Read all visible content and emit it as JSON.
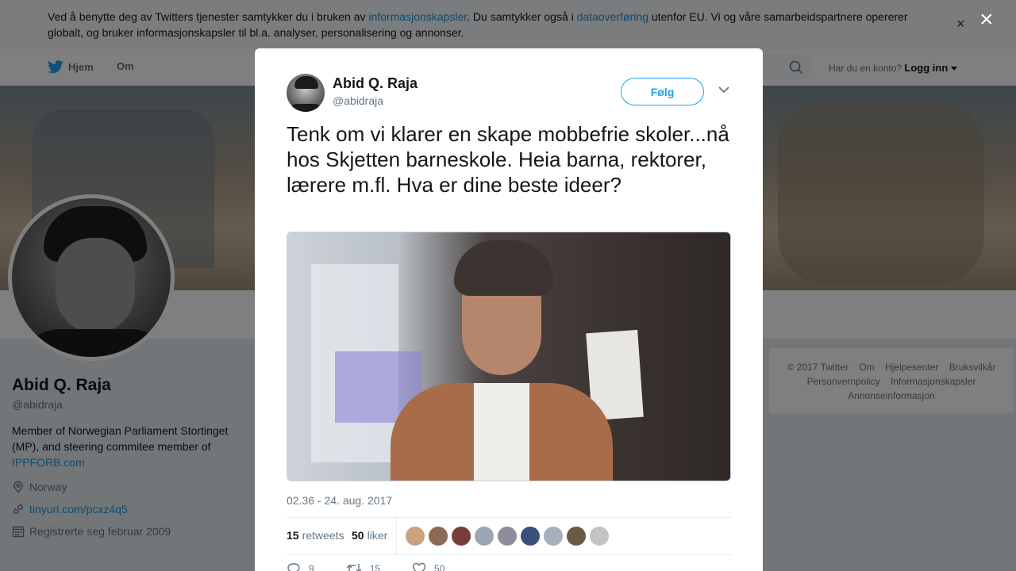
{
  "cookie_banner": {
    "text_before": "Ved å benytte deg av Twitters tjenester samtykker du i bruken av ",
    "link1": "informasjonskapsler",
    "text_middle": ". Du samtykker også i ",
    "link2": "dataoverføring",
    "text_after": " utenfor EU. Vi og våre samarbeidspartnere opererer globalt, og bruker informasjonskapsler til bl.a. analyser, personalisering og annonser.",
    "close": "×"
  },
  "nav": {
    "home": "Hjem",
    "about": "Om",
    "login_prompt": "Har du en konto?",
    "login": "Logg inn"
  },
  "profile": {
    "name": "Abid Q. Raja",
    "handle": "@abidraja",
    "bio": "Member of Norwegian Parliament Stortinget (MP), and steering commitee member of",
    "bio_link": "IPPFORB.com",
    "location": "Norway",
    "url": "tinyurl.com/pcxz4q5",
    "joined": "Registrerte seg februar 2009"
  },
  "footer": {
    "items": [
      "© 2017 Twitter",
      "Om",
      "Hjelpesenter",
      "Bruksvilkår",
      "Personvernpolicy",
      "Informasjonskapsler",
      "Annonseinformasjon"
    ]
  },
  "modal": {
    "close": "×",
    "name": "Abid Q. Raja",
    "handle": "@abidraja",
    "follow": "Følg",
    "tweet": "Tenk om vi klarer en skape mobbefrie skoler...nå hos Skjetten barneskole. Heia barna, rektorer, lærere m.fl. Hva er dine beste ideer?",
    "timestamp": "02.36 - 24. aug. 2017",
    "retweets_count": "15",
    "retweets_label": "retweets",
    "likes_count": "50",
    "likes_label": "liker",
    "liker_colors": [
      "#c9a27e",
      "#8c6a55",
      "#7a3b3b",
      "#9aa7b3",
      "#8e8e9a",
      "#3a4f7a",
      "#a5b0ba",
      "#6a5a44",
      "#c4c4c4"
    ],
    "actions": {
      "reply_count": "9",
      "retweet_count": "15",
      "like_count": "50"
    }
  }
}
